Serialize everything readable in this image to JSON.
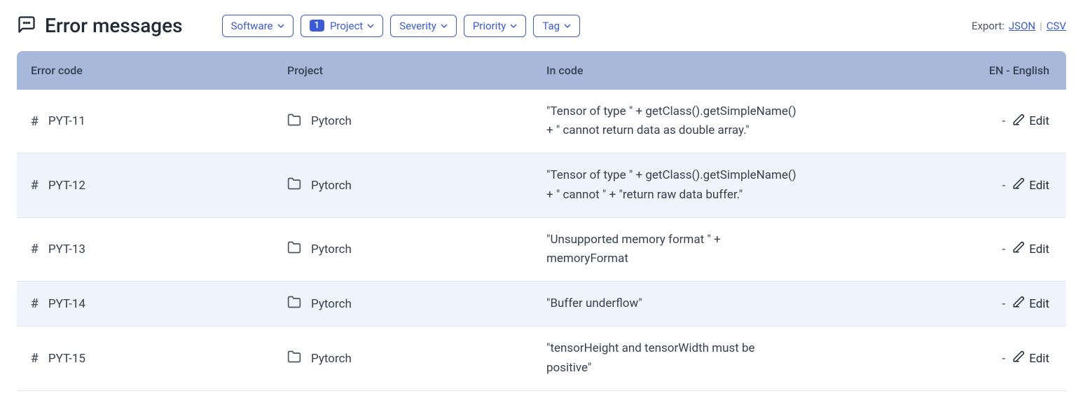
{
  "header": {
    "title": "Error messages",
    "filters": [
      {
        "label": "Software",
        "count": null
      },
      {
        "label": "Project",
        "count": "1"
      },
      {
        "label": "Severity",
        "count": null
      },
      {
        "label": "Priority",
        "count": null
      },
      {
        "label": "Tag",
        "count": null
      }
    ],
    "export": {
      "label": "Export:",
      "json": "JSON",
      "csv": "CSV"
    }
  },
  "table": {
    "columns": {
      "code": "Error code",
      "project": "Project",
      "incode": "In code",
      "en": "EN - English"
    },
    "edit_label": "Edit",
    "dash": "-",
    "rows": [
      {
        "code": "PYT-11",
        "project": "Pytorch",
        "incode": "\"Tensor of type \" + getClass().getSimpleName() + \" cannot return data as double array.\""
      },
      {
        "code": "PYT-12",
        "project": "Pytorch",
        "incode": "\"Tensor of type \" + getClass().getSimpleName() + \" cannot \" + \"return raw data buffer.\""
      },
      {
        "code": "PYT-13",
        "project": "Pytorch",
        "incode": "\"Unsupported memory format \" + memoryFormat"
      },
      {
        "code": "PYT-14",
        "project": "Pytorch",
        "incode": "\"Buffer underflow\""
      },
      {
        "code": "PYT-15",
        "project": "Pytorch",
        "incode": "\"tensorHeight and tensorWidth must be positive\""
      }
    ]
  }
}
